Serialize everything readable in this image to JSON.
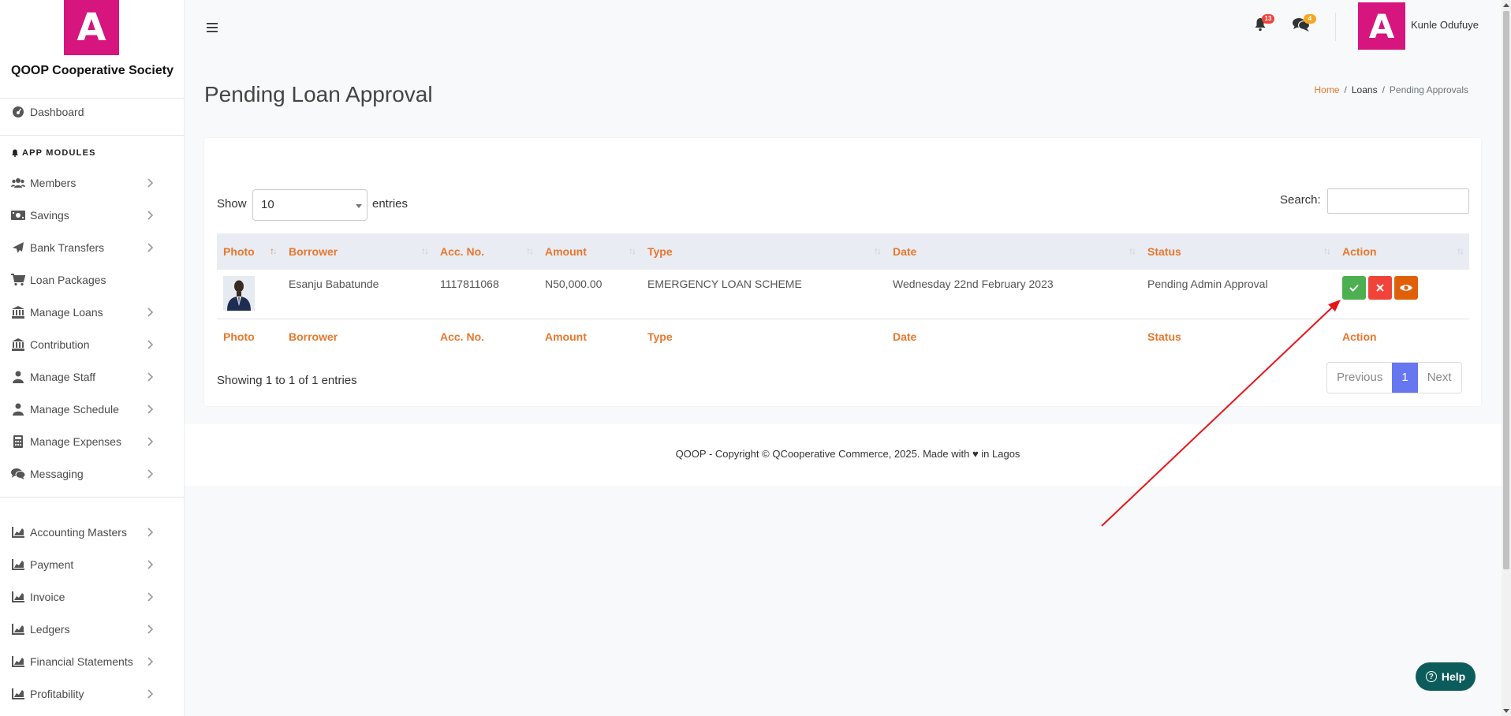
{
  "brand": {
    "logo_letter": "A",
    "name": "QOOP Cooperative Society",
    "color": "#d6157f"
  },
  "sidebar": {
    "dashboard": {
      "label": "Dashboard",
      "icon": "dashboard-icon"
    },
    "section_title": "APP MODULES",
    "modules": [
      {
        "label": "Members",
        "icon": "users-icon",
        "has_chevron": true
      },
      {
        "label": "Savings",
        "icon": "money-icon",
        "has_chevron": true
      },
      {
        "label": "Bank Transfers",
        "icon": "paper-plane-icon",
        "has_chevron": true
      },
      {
        "label": "Loan Packages",
        "icon": "cart-icon",
        "has_chevron": false
      },
      {
        "label": "Manage Loans",
        "icon": "bank-icon",
        "has_chevron": true
      },
      {
        "label": "Contribution",
        "icon": "bank-icon",
        "has_chevron": true
      },
      {
        "label": "Manage Staff",
        "icon": "user-icon",
        "has_chevron": true
      },
      {
        "label": "Manage Schedule",
        "icon": "user-icon",
        "has_chevron": true
      },
      {
        "label": "Manage Expenses",
        "icon": "calculator-icon",
        "has_chevron": true
      },
      {
        "label": "Messaging",
        "icon": "chat-icon",
        "has_chevron": true
      }
    ],
    "accounting": [
      {
        "label": "Accounting Masters",
        "icon": "chart-icon"
      },
      {
        "label": "Payment",
        "icon": "chart-icon"
      },
      {
        "label": "Invoice",
        "icon": "chart-icon"
      },
      {
        "label": "Ledgers",
        "icon": "chart-icon"
      },
      {
        "label": "Financial Statements",
        "icon": "chart-icon"
      },
      {
        "label": "Profitability",
        "icon": "chart-icon"
      }
    ]
  },
  "topbar": {
    "notifications_count": "13",
    "messages_count": "4",
    "user_initial": "A",
    "user_name": "Kunle Odufuye"
  },
  "page": {
    "title": "Pending Loan Approval",
    "breadcrumb": {
      "home": "Home",
      "section": "Loans",
      "current": "Pending Approvals"
    }
  },
  "table_controls": {
    "show_label": "Show",
    "page_size": "10",
    "entries_label": "entries",
    "search_label": "Search:",
    "search_value": ""
  },
  "table": {
    "columns": [
      "Photo",
      "Borrower",
      "Acc. No.",
      "Amount",
      "Type",
      "Date",
      "Status",
      "Action"
    ],
    "rows": [
      {
        "borrower": "Esanju Babatunde",
        "account_no": "1117811068",
        "amount": "N50,000.00",
        "type": "EMERGENCY LOAN SCHEME",
        "date": "Wednesday 22nd February 2023",
        "status": "Pending Admin Approval"
      }
    ]
  },
  "pagination": {
    "info": "Showing 1 to 1 of 1 entries",
    "previous": "Previous",
    "current_page": "1",
    "next": "Next"
  },
  "footer": {
    "text": "QOOP - Copyright © QCooperative Commerce, 2025. Made with ♥ in Lagos"
  },
  "help": {
    "label": "Help"
  },
  "colors": {
    "accent": "#e8772e",
    "approve": "#4caf50",
    "reject": "#f0443a",
    "view": "#e0600a",
    "pager_active": "#6777ef",
    "annotation_arrow": "#e8141a"
  }
}
